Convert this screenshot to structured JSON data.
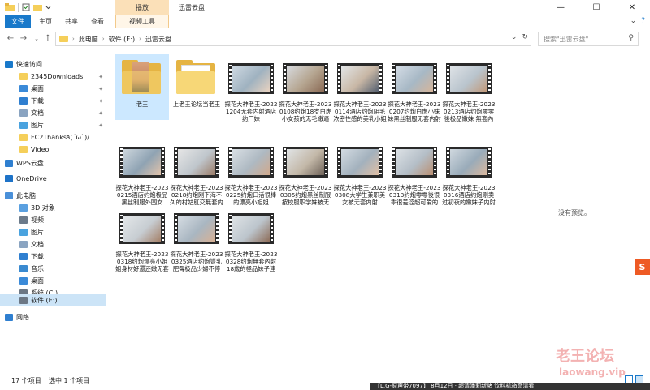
{
  "window": {
    "title": "迅雷云盘",
    "manage_tab": "播放",
    "min": "—",
    "max": "☐",
    "close": "✕"
  },
  "ribbon": {
    "file": "文件",
    "home": "主页",
    "share": "共享",
    "view": "查看",
    "video_tools": "视频工具"
  },
  "address": {
    "crumbs": [
      "此电脑",
      "软件 (E:)",
      "迅雷云盘"
    ],
    "search_placeholder": "搜索\"迅雷云盘\""
  },
  "sidebar": {
    "items": [
      {
        "label": "快速访问",
        "pinned": false,
        "color": "#1979ca"
      },
      {
        "label": "2345Downloads",
        "pinned": true,
        "color": "#f5cf5a"
      },
      {
        "label": "桌面",
        "pinned": true,
        "color": "#3b8ad8"
      },
      {
        "label": "下载",
        "pinned": true,
        "color": "#2f7fd0"
      },
      {
        "label": "文档",
        "pinned": true,
        "color": "#8aa4c1"
      },
      {
        "label": "图片",
        "pinned": true,
        "color": "#4aa3df"
      },
      {
        "label": "FC2Thanks٩(ˊωˋ)/",
        "pinned": false,
        "color": "#f5cf5a"
      },
      {
        "label": "Video",
        "pinned": false,
        "color": "#f5cf5a"
      },
      {
        "label": "WPS云盘",
        "pinned": false,
        "color": "#2f7fd0"
      },
      {
        "label": "OneDrive",
        "pinned": false,
        "color": "#1e73c8"
      },
      {
        "label": "此电脑",
        "pinned": false,
        "color": "#4a90d9"
      },
      {
        "label": "3D 对象",
        "pinned": false,
        "color": "#5aa0e0"
      },
      {
        "label": "视频",
        "pinned": false,
        "color": "#6c7b8b"
      },
      {
        "label": "图片",
        "pinned": false,
        "color": "#4aa3df"
      },
      {
        "label": "文档",
        "pinned": false,
        "color": "#8aa4c1"
      },
      {
        "label": "下载",
        "pinned": false,
        "color": "#2f7fd0"
      },
      {
        "label": "音乐",
        "pinned": false,
        "color": "#3a8ad0"
      },
      {
        "label": "桌面",
        "pinned": false,
        "color": "#3b8ad8"
      },
      {
        "label": "系统 (C:)",
        "pinned": false,
        "color": "#6b7785"
      },
      {
        "label": "软件 (E:)",
        "pinned": false,
        "color": "#6b7785"
      },
      {
        "label": "网络",
        "pinned": false,
        "color": "#2f7fd0"
      }
    ]
  },
  "files": [
    {
      "label": "老王",
      "kind": "folder-photo"
    },
    {
      "label": "上老王论坛当老王",
      "kind": "folder"
    },
    {
      "label": "探花大神老王-20221204无套内射酒店约厂妹",
      "kind": "video"
    },
    {
      "label": "探花大神老王-20230108约炮18岁白虎小女孩的无毛嫩逼浓…",
      "kind": "video"
    },
    {
      "label": "探花大神老王-20230114酒店约炮阴毛浓密性感的美乳小姐姐",
      "kind": "video"
    },
    {
      "label": "探花大神老王-20230207约炮白虎小妹妹黑丝制服无套内射",
      "kind": "video"
    },
    {
      "label": "探花大神老王-20230213酒店约炮零零後极品嫩妹 無套內射",
      "kind": "video"
    },
    {
      "label": "探花大神老王-20230215酒店约炮极品黑丝制服外围女",
      "kind": "video"
    },
    {
      "label": "探花大神老王-20230218约炮刚下海不久的村姑肛交無套内射",
      "kind": "video"
    },
    {
      "label": "探花大神老王-20230225约炮口活很棒的漂亮小姐姐",
      "kind": "video"
    },
    {
      "label": "探花大神老王-20230305约炮黑丝制服按校服职学妹被无套…",
      "kind": "video"
    },
    {
      "label": "探花大神老王-20230308大学生兼职美女被无套内射",
      "kind": "video"
    },
    {
      "label": "探花大神老王-20230313约炮零零後很乖很羞涩超可爱的妹…",
      "kind": "video"
    },
    {
      "label": "探花大神老王-20230316酒店约炮刚卖过初夜的嫩妹子内射她",
      "kind": "video"
    },
    {
      "label": "探花大神老王-20230318约炮漂亮小姐姐身材好還还嫩无套",
      "kind": "video"
    },
    {
      "label": "探花大神老王-20230325酒店约炮豐乳肥臀极品少婦不停幹…",
      "kind": "video"
    },
    {
      "label": "探花大神老王-20230328约炮無套內射18歲的極品妹子連邊…",
      "kind": "video"
    }
  ],
  "preview": {
    "empty_text": "没有预览。"
  },
  "status": {
    "count": "17 个项目",
    "selected": "选中 1 个项目"
  },
  "watermark": {
    "text": "老王论坛",
    "url": "laowang.vip"
  },
  "overlay": {
    "s_logo": "S",
    "bottom_text": "【L.G-原声带7097】 8月12日 · 超清潘莉新猪 饮料机箱高清看"
  }
}
